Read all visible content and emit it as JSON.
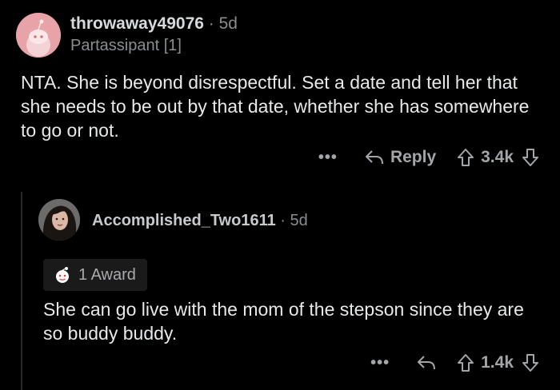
{
  "comment": {
    "username": "throwaway49076",
    "separator": "·",
    "age": "5d",
    "flair": "Partassipant [1]",
    "body": "NTA. She is beyond disrespectful. Set a date and tell her that she needs to be out by that date, whether she has somewhere to go or not.",
    "more": "•••",
    "reply_label": "Reply",
    "score": "3.4k"
  },
  "reply": {
    "username": "Accomplished_Two1611",
    "separator": "·",
    "age": "5d",
    "award": "1 Award",
    "body": "She can go live with the mom of the stepson since they are so buddy buddy.",
    "more": "•••",
    "score": "1.4k"
  },
  "icons": {
    "avatar1": "snoo-avatar-icon",
    "avatar2": "user-portrait-avatar",
    "reply": "reply-arrow-icon",
    "upvote": "upvote-arrow-icon",
    "downvote": "downvote-arrow-icon",
    "award": "award-icon"
  },
  "colors": {
    "background": "#000000",
    "text": "#e6e8ea",
    "muted": "#8a8d90",
    "avatar1_bg": "#e8a3a8"
  }
}
